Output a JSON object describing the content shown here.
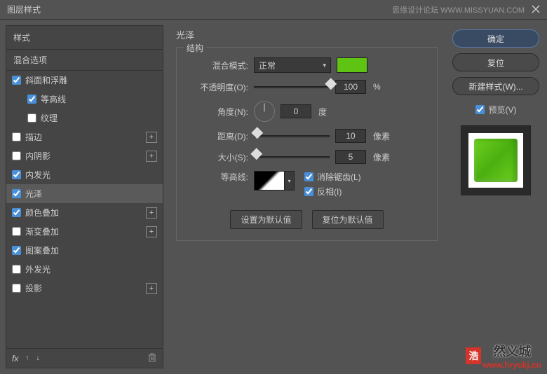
{
  "titlebar": {
    "title": "图层样式",
    "watermark": "思缘设计论坛  WWW.MISSYUAN.COM"
  },
  "left": {
    "header": "样式",
    "blend_options": "混合选项",
    "items": [
      {
        "label": "斜面和浮雕",
        "checked": true,
        "has_add": false,
        "indent": false
      },
      {
        "label": "等高线",
        "checked": true,
        "has_add": false,
        "indent": true
      },
      {
        "label": "纹理",
        "checked": false,
        "has_add": false,
        "indent": true
      },
      {
        "label": "描边",
        "checked": false,
        "has_add": true,
        "indent": false
      },
      {
        "label": "内阴影",
        "checked": false,
        "has_add": true,
        "indent": false
      },
      {
        "label": "内发光",
        "checked": true,
        "has_add": false,
        "indent": false
      },
      {
        "label": "光泽",
        "checked": true,
        "has_add": false,
        "indent": false,
        "selected": true
      },
      {
        "label": "颜色叠加",
        "checked": true,
        "has_add": true,
        "indent": false
      },
      {
        "label": "渐变叠加",
        "checked": false,
        "has_add": true,
        "indent": false
      },
      {
        "label": "图案叠加",
        "checked": true,
        "has_add": false,
        "indent": false
      },
      {
        "label": "外发光",
        "checked": false,
        "has_add": false,
        "indent": false
      },
      {
        "label": "投影",
        "checked": false,
        "has_add": true,
        "indent": false
      }
    ],
    "footer_fx": "fx"
  },
  "center": {
    "title": "光泽",
    "structure_legend": "结构",
    "blend_mode_label": "混合模式:",
    "blend_mode_value": "正常",
    "color_value": "#5ec312",
    "opacity_label": "不透明度(O):",
    "opacity_value": "100",
    "opacity_unit": "%",
    "angle_label": "角度(N):",
    "angle_value": "0",
    "angle_unit": "度",
    "distance_label": "距离(D):",
    "distance_value": "10",
    "distance_unit": "像素",
    "size_label": "大小(S):",
    "size_value": "5",
    "size_unit": "像素",
    "contour_label": "等高线:",
    "antialias_label": "消除锯齿(L)",
    "invert_label": "反相(I)",
    "set_default": "设置为默认值",
    "reset_default": "复位为默认值"
  },
  "right": {
    "ok": "确定",
    "cancel": "复位",
    "new_style": "新建样式(W)...",
    "preview": "预览(V)"
  },
  "bottom_watermark": {
    "badge": "浩",
    "cn": "然义城",
    "url": "www.hryckj.cn"
  }
}
